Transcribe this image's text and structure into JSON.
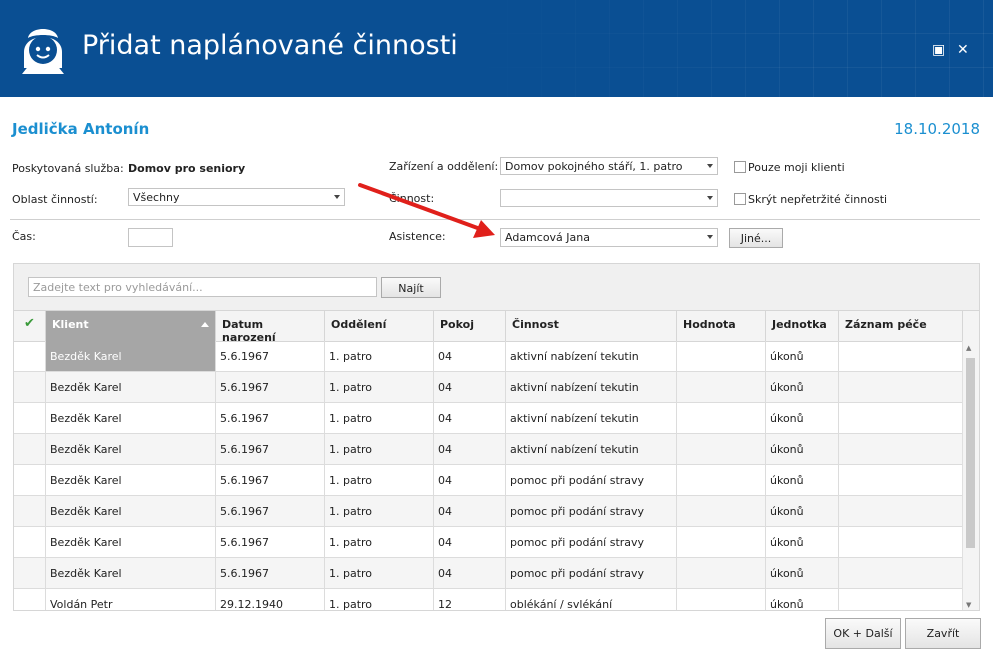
{
  "window": {
    "title": "Přidat naplánované činnosti"
  },
  "header": {
    "client_name": "Jedlička Antonín",
    "date": "18.10.2018"
  },
  "form": {
    "service_label": "Poskytovaná služba:",
    "service_value": "Domov pro seniory",
    "facility_label": "Zařízení a oddělení:",
    "facility_value": "Domov pokojného stáří, 1. patro",
    "only_my_clients_label": "Pouze moji klienti",
    "area_label": "Oblast činností:",
    "area_value": "Všechny",
    "activity_label": "Činnost:",
    "activity_value": "",
    "hide_continuous_label": "Skrýt nepřetržité činnosti",
    "time_label": "Čas:",
    "time_value": "",
    "assistance_label": "Asistence:",
    "assistance_value": "Adamcová Jana",
    "other_button": "Jiné..."
  },
  "search": {
    "placeholder": "Zadejte text pro vyhledávání...",
    "button": "Najít"
  },
  "table": {
    "columns": [
      "Klient",
      "Datum narození",
      "Oddělení",
      "Pokoj",
      "Činnost",
      "Hodnota",
      "Jednotka",
      "Záznam péče"
    ],
    "rows": [
      [
        "Bezděk Karel",
        "5.6.1967",
        "1. patro",
        "04",
        "aktivní nabízení tekutin",
        "",
        "úkonů",
        ""
      ],
      [
        "Bezděk Karel",
        "5.6.1967",
        "1. patro",
        "04",
        "aktivní nabízení tekutin",
        "",
        "úkonů",
        ""
      ],
      [
        "Bezděk Karel",
        "5.6.1967",
        "1. patro",
        "04",
        "aktivní nabízení tekutin",
        "",
        "úkonů",
        ""
      ],
      [
        "Bezděk Karel",
        "5.6.1967",
        "1. patro",
        "04",
        "aktivní nabízení tekutin",
        "",
        "úkonů",
        ""
      ],
      [
        "Bezděk Karel",
        "5.6.1967",
        "1. patro",
        "04",
        "pomoc při podání stravy",
        "",
        "úkonů",
        ""
      ],
      [
        "Bezděk Karel",
        "5.6.1967",
        "1. patro",
        "04",
        "pomoc při podání stravy",
        "",
        "úkonů",
        ""
      ],
      [
        "Bezděk Karel",
        "5.6.1967",
        "1. patro",
        "04",
        "pomoc při podání stravy",
        "",
        "úkonů",
        ""
      ],
      [
        "Bezděk Karel",
        "5.6.1967",
        "1. patro",
        "04",
        "pomoc při podání stravy",
        "",
        "úkonů",
        ""
      ],
      [
        "Voldán Petr",
        "29.12.1940",
        "1. patro",
        "12",
        "oblékání / svlékání",
        "",
        "úkonů",
        ""
      ]
    ]
  },
  "footer": {
    "ok_next": "OK + Další",
    "close": "Zavřít"
  },
  "colors": {
    "titlebar": "#0a4f93",
    "accent": "#1b8fd0",
    "arrow": "#e0201b"
  }
}
